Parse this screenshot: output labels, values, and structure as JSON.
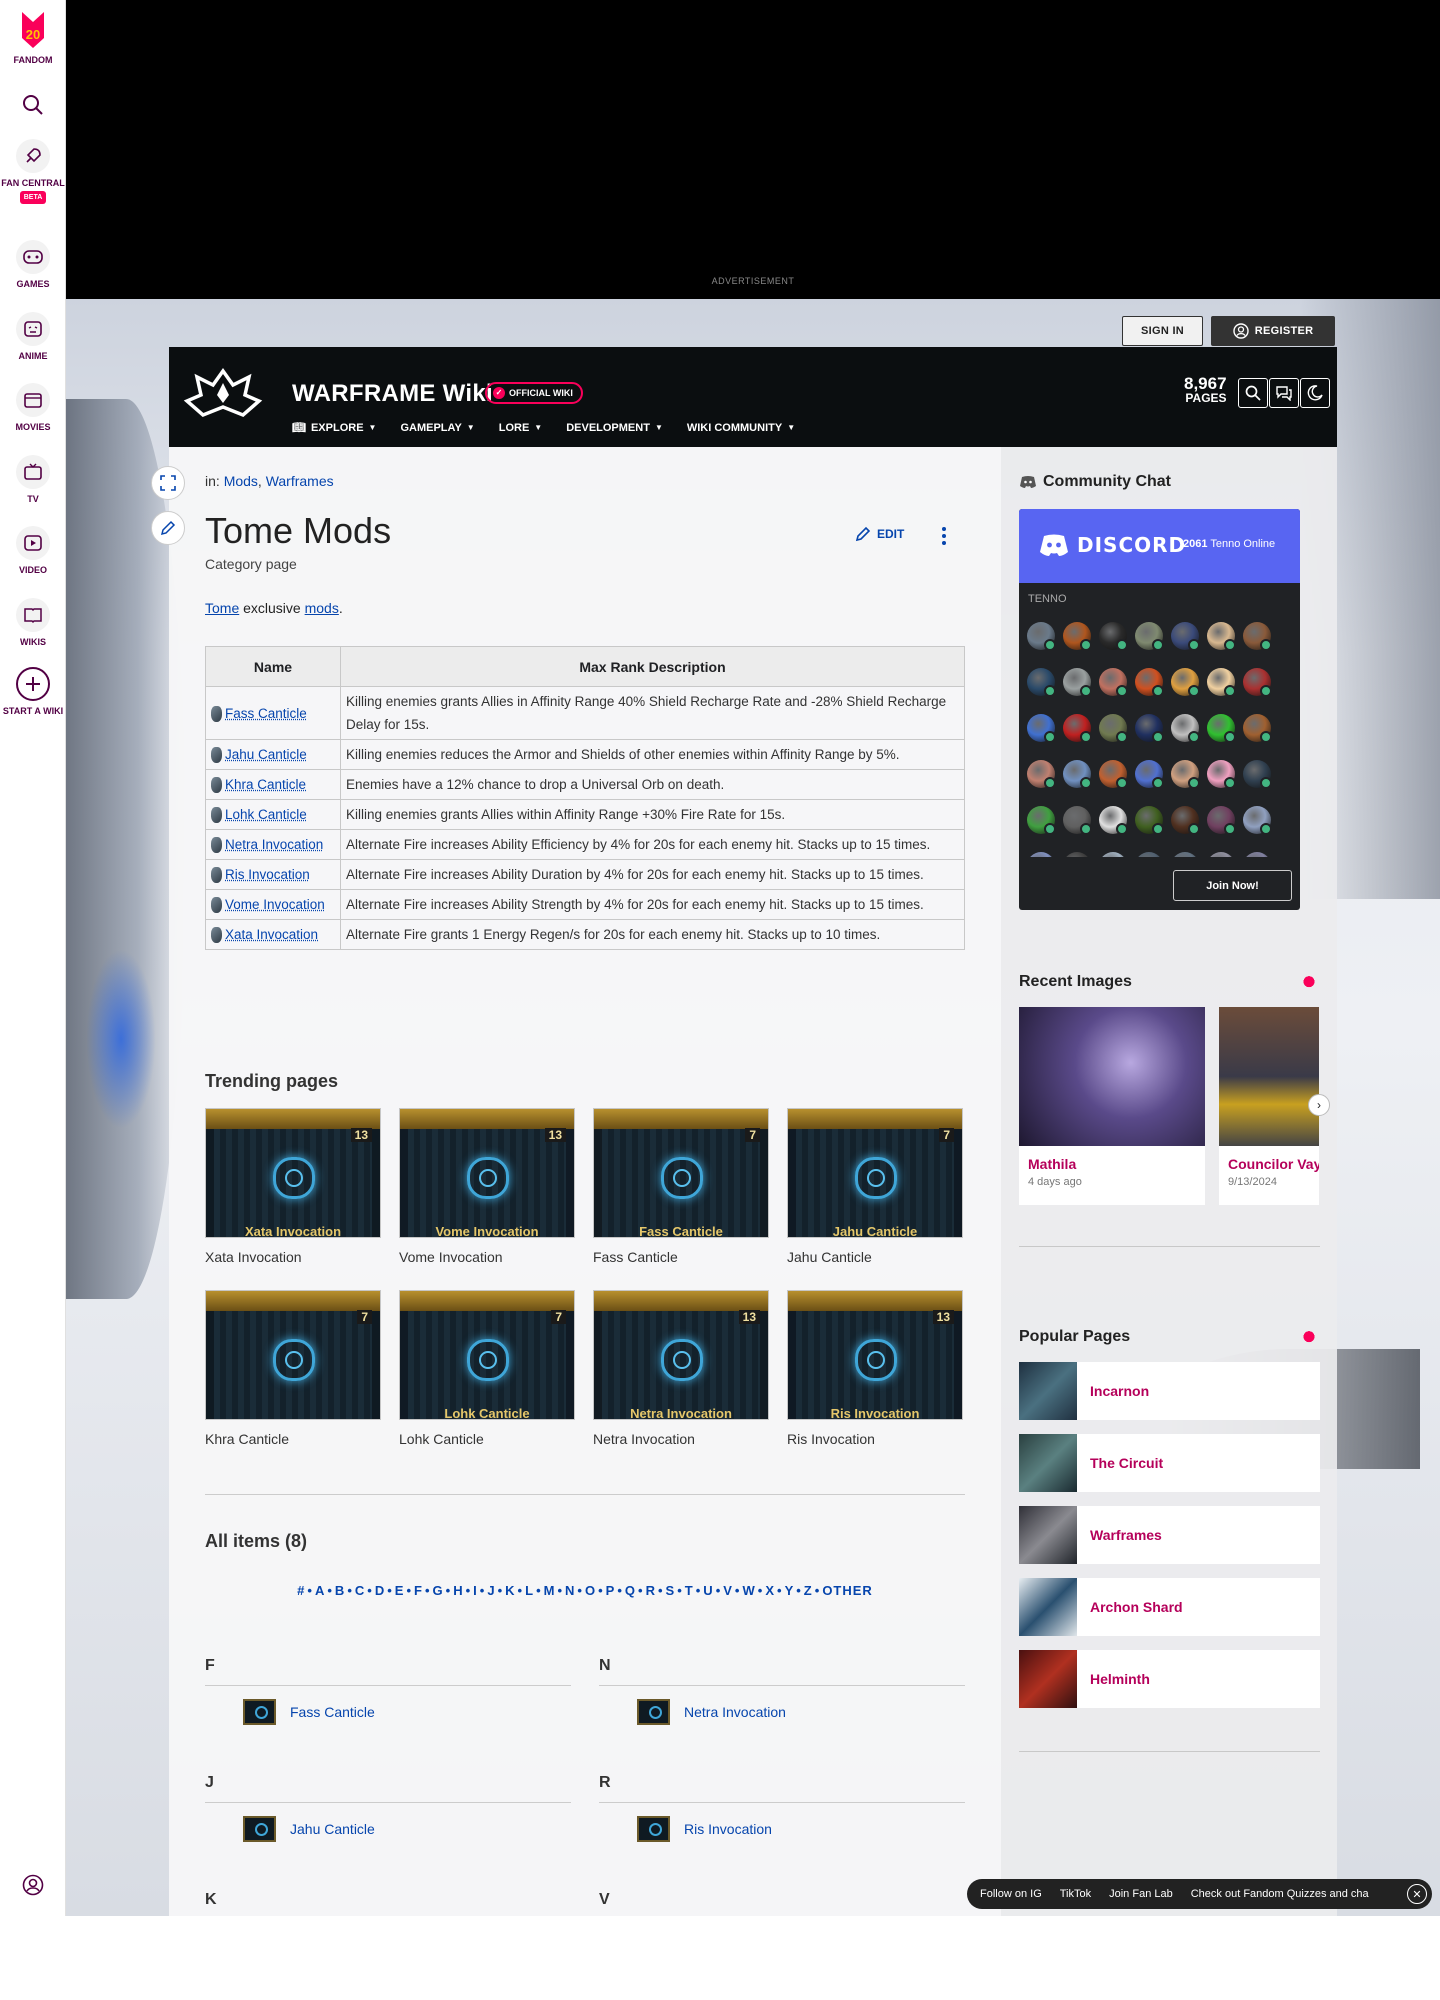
{
  "global_nav": {
    "logo_label": "FANDOM",
    "items": [
      {
        "label": "FAN CENTRAL",
        "badge": "BETA"
      },
      {
        "label": "GAMES"
      },
      {
        "label": "ANIME"
      },
      {
        "label": "MOVIES"
      },
      {
        "label": "TV"
      },
      {
        "label": "VIDEO"
      },
      {
        "label": "WIKIS"
      },
      {
        "label": "START A WIKI"
      }
    ]
  },
  "ad": {
    "label": "ADVERTISEMENT"
  },
  "auth": {
    "signin": "SIGN IN",
    "register": "REGISTER"
  },
  "wiki_header": {
    "title": "WARFRAME Wiki",
    "official_badge": "OFFICIAL WIKI",
    "pages_count": "8,967",
    "pages_label": "PAGES",
    "nav": [
      "EXPLORE",
      "GAMEPLAY",
      "LORE",
      "DEVELOPMENT",
      "WIKI COMMUNITY"
    ]
  },
  "page": {
    "crumb_prefix": "in:",
    "categories": [
      "Mods",
      "Warframes"
    ],
    "title": "Tome Mods",
    "subtitle": "Category page",
    "edit_label": "EDIT",
    "intro_link1": "Tome",
    "intro_mid": "exclusive",
    "intro_link2": "mods",
    "intro_end": "."
  },
  "mod_table": {
    "headers": [
      "Name",
      "Max Rank Description"
    ],
    "rows": [
      {
        "name": "Fass Canticle",
        "desc": "Killing enemies grants Allies in Affinity Range 40% Shield Recharge Rate and -28% Shield Recharge Delay for 15s."
      },
      {
        "name": "Jahu Canticle",
        "desc": "Killing enemies reduces the Armor and Shields of other enemies within Affinity Range by 5%."
      },
      {
        "name": "Khra Canticle",
        "desc": "Enemies have a 12% chance to drop a Universal Orb on death."
      },
      {
        "name": "Lohk Canticle",
        "desc": "Killing enemies grants Allies within Affinity Range +30% Fire Rate for 15s."
      },
      {
        "name": "Netra Invocation",
        "desc": "Alternate Fire increases Ability Efficiency by 4% for 20s for each enemy hit. Stacks up to 15 times."
      },
      {
        "name": "Ris Invocation",
        "desc": "Alternate Fire increases Ability Duration by 4% for 20s for each enemy hit. Stacks up to 15 times."
      },
      {
        "name": "Vome Invocation",
        "desc": "Alternate Fire increases Ability Strength by 4% for 20s for each enemy hit. Stacks up to 15 times."
      },
      {
        "name": "Xata Invocation",
        "desc": "Alternate Fire grants 1 Energy Regen/s for 20s for each enemy hit. Stacks up to 10 times."
      }
    ]
  },
  "trending": {
    "heading": "Trending pages",
    "cards": [
      {
        "caption": "Xata Invocation",
        "card_label": "Xata Invocation",
        "rank": "13"
      },
      {
        "caption": "Vome Invocation",
        "card_label": "Vome Invocation",
        "rank": "13"
      },
      {
        "caption": "Fass Canticle",
        "card_label": "Fass Canticle",
        "rank": "7"
      },
      {
        "caption": "Jahu Canticle",
        "card_label": "Jahu Canticle",
        "rank": "7"
      },
      {
        "caption": "Khra Canticle",
        "card_label": "",
        "rank": "7"
      },
      {
        "caption": "Lohk Canticle",
        "card_label": "Lohk Canticle",
        "rank": "7"
      },
      {
        "caption": "Netra Invocation",
        "card_label": "Netra Invocation",
        "rank": "13"
      },
      {
        "caption": "Ris Invocation",
        "card_label": "Ris Invocation",
        "rank": "13"
      }
    ]
  },
  "all_items": {
    "heading": "All items (8)",
    "letters": [
      "#",
      "A",
      "B",
      "C",
      "D",
      "E",
      "F",
      "G",
      "H",
      "I",
      "J",
      "K",
      "L",
      "M",
      "N",
      "O",
      "P",
      "Q",
      "R",
      "S",
      "T",
      "U",
      "V",
      "W",
      "X",
      "Y",
      "Z",
      "OTHER"
    ],
    "groups": [
      {
        "letter": "F",
        "item": "Fass Canticle"
      },
      {
        "letter": "N",
        "item": "Netra Invocation"
      },
      {
        "letter": "J",
        "item": "Jahu Canticle"
      },
      {
        "letter": "R",
        "item": "Ris Invocation"
      },
      {
        "letter": "K",
        "item": ""
      },
      {
        "letter": "V",
        "item": ""
      }
    ]
  },
  "community_chat": {
    "heading": "Community Chat",
    "discord_label": "DISCORD",
    "online_count": "2061",
    "online_label": "Tenno Online",
    "group_label": "TENNO",
    "join_label": "Join Now!"
  },
  "recent_images": {
    "heading": "Recent Images",
    "items": [
      {
        "name": "Mathila",
        "date": "4 days ago"
      },
      {
        "name": "Councilor Vay",
        "date": "9/13/2024"
      }
    ]
  },
  "popular_pages": {
    "heading": "Popular Pages",
    "items": [
      "Incarnon",
      "The Circuit",
      "Warframes",
      "Archon Shard",
      "Helminth"
    ]
  },
  "footer_bar": {
    "links": [
      "Follow on IG",
      "TikTok",
      "Join Fan Lab",
      "Check out Fandom Quizzes and cha"
    ]
  },
  "colors": {
    "brand": "#fa005a",
    "link": "#0645ad",
    "discord": "#5865f2"
  }
}
